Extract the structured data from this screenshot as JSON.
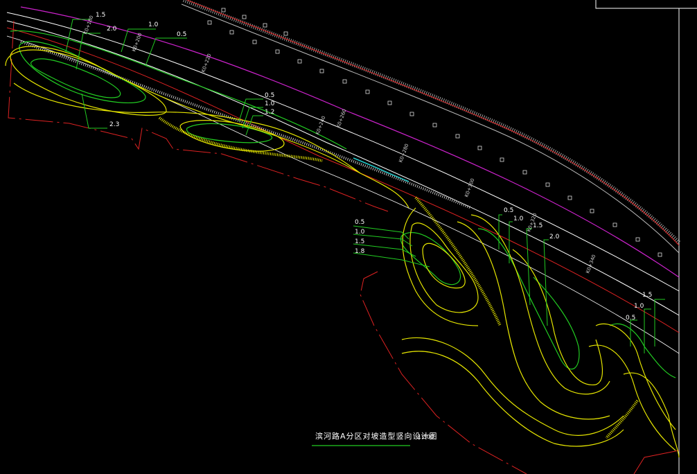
{
  "drawing": {
    "title": "滨河路A分区对坡造型竖向设计图",
    "scale": "1:500"
  },
  "colors": {
    "background": "#000000",
    "contour_green": "#22cc22",
    "contour_yellow": "#e6e600",
    "boundary_red": "#dd2222",
    "road_magenta": "#cc22cc",
    "road_white": "#ffffff",
    "hatch_grey": "#9a9a9a"
  },
  "contour_labels": {
    "group_top_left": [
      "1.5",
      "2.0",
      "1.0",
      "0.5",
      "2.3"
    ],
    "group_mid": [
      "0.5",
      "1.0",
      "1.2"
    ],
    "group_center": [
      "0.5",
      "1.0",
      "1.5",
      "1.8"
    ],
    "group_right": [
      "0.5",
      "1.0",
      "1.5",
      "2.0"
    ],
    "group_far_right": [
      "1.5",
      "1.0",
      "0.5"
    ]
  },
  "stations": [
    "K0+180",
    "K0+200",
    "K0+220",
    "K0+240",
    "K0+260",
    "K0+280",
    "K0+300",
    "K0+320",
    "K0+340"
  ]
}
